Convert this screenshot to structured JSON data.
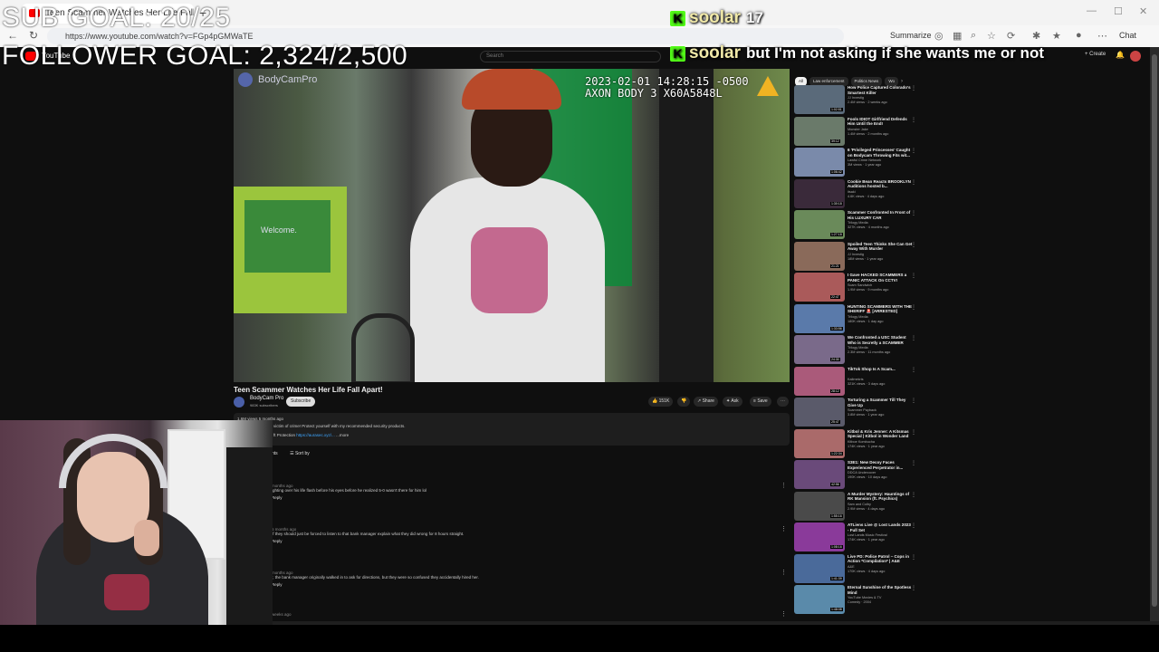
{
  "browser": {
    "tab_title": "Teen Scammer Watches Her Life Fall Apart",
    "url": "https://www.youtube.com/watch?v=FGp4pGMWaTE",
    "summarize_label": "Summarize",
    "chat_label": "Chat"
  },
  "youtube": {
    "logo_text": "YouTube",
    "search_placeholder": "Search",
    "create_label": "+ Create",
    "video": {
      "watermark_channel": "BodyCamPro",
      "hud_line1": "2023-02-01 14:28:15 -0500",
      "hud_line2": "AXON BODY 3 X60A5848L",
      "sign_text": "Welcome.",
      "title": "Teen Scammer Watches Her Life Fall Apart!",
      "channel": "BodyCam Pro",
      "subscribers": "983K subscribers",
      "subscribe_label": "Subscribe",
      "likes": "151K",
      "share_label": "Share",
      "ask_label": "Ask",
      "save_label": "Save",
      "views_line": "1.6M views  5 months ago",
      "desc_line1": "victim of crime! Protect yourself with my recommended security products.",
      "desc_line2_prefix": "ft Protection",
      "desc_link": "https://aurasec.xyz/...",
      "desc_more": "...more"
    },
    "comments": {
      "header": "nts",
      "sort_label": "Sort by",
      "items": [
        {
          "meta": "months ago",
          "text": "ighting over his life flash before his eyes before he realized 5-0 wasn't there for him lol",
          "reply": "Reply"
        },
        {
          "meta": "5 months ago",
          "text": "If they should just be forced to listen to that bank manager explain what they did wrong for 8 hours straight.",
          "reply": "Reply"
        },
        {
          "meta": "months ago",
          "text": "r, the bank manager originally walked in to ask for directions, but they were so confused they accidentally hired her.",
          "reply": "Reply"
        },
        {
          "meta": "weeks ago",
          "text": "",
          "reply": ""
        }
      ]
    },
    "chips": [
      "All",
      "Law enforcement",
      "Politics News",
      "Wo"
    ],
    "recommendations": [
      {
        "title": "How Police Captured Colorado's Smartest Killer",
        "channel": "JJ Investig",
        "meta": "2.4M views · 2 weeks ago",
        "duration": "1:02:51",
        "color": "#5a6a7a"
      },
      {
        "title": "Fools IDIOT Girlfriend Defends Him Until the End!",
        "channel": "Monster Jake",
        "meta": "1.4M views · 2 months ago",
        "duration": "39:12",
        "color": "#6a7a6a"
      },
      {
        "title": "6 'Privileged Princesses' Caught on Bodycam Throwing Fits wit...",
        "channel": "Lawful Crime Network",
        "meta": "3M views · 1 year ago",
        "duration": "1:06:42",
        "color": "#7a8aaa"
      },
      {
        "title": "Cookie Bean Reacts BROOKLYN Auditions hosted b...",
        "channel": "itsaki",
        "meta": "4.6K views · 4 days ago",
        "duration": "1:30:18",
        "color": "#3a2a3a"
      },
      {
        "title": "Scammer Confronted In Front of His LUXURY CAR",
        "channel": "Trilogy Media",
        "meta": "327K views · 4 months ago",
        "duration": "1:27:18",
        "color": "#6a8a5a"
      },
      {
        "title": "Spoiled Teen Thinks She Can Get Away With Murder",
        "channel": "JJ Investig",
        "meta": "18M views · 1 year ago",
        "duration": "21:21",
        "color": "#8a6a5a"
      },
      {
        "title": "I Gave HACKED SCAMMERS a PANIC ATTACK On CCTV!",
        "channel": "Scam Sandwich",
        "meta": "1.9M views · 9 months ago",
        "duration": "22:47",
        "color": "#aa5a5a"
      },
      {
        "title": "HUNTING SCAMMERS WITH THE SHERIFF 🚨 [ARRESTED]",
        "channel": "Trilogy Media",
        "meta": "180K views · 1 day ago",
        "duration": "1:33:56",
        "color": "#5a7aaa"
      },
      {
        "title": "We Confronted a USC Student Who is Secretly a SCAMMER",
        "channel": "Trilogy Media",
        "meta": "2.3M views · 11 months ago",
        "duration": "24:30",
        "color": "#7a6a8a"
      },
      {
        "title": "TikTok Shop Is A Scam...",
        "channel": "Kallmekris",
        "meta": "321K views · 3 days ago",
        "duration": "28:12",
        "color": "#aa5a7a"
      },
      {
        "title": "Torturing a Scammer Till They Give Up",
        "channel": "Scammer Payback",
        "meta": "3.8M views · 1 year ago",
        "duration": "25:47",
        "color": "#5a5a6a"
      },
      {
        "title": "Kitbol & Kris Jenner: A Kitsmas Special | Kitbol in Wonder Land",
        "channel": "Kitboe Kombucha",
        "meta": "174K views · 1 year ago",
        "duration": "1:22:34",
        "color": "#aa6a6a"
      },
      {
        "title": "S3E1: New Decoy Faces Experienced Perpetrator in...",
        "channel": "DDCA Undercover",
        "meta": "190K views · 10 days ago",
        "duration": "42:56",
        "color": "#6a4a7a"
      },
      {
        "title": "A Murder Mystery: Hauntings of RK Mansion (ft. Psychics)",
        "channel": "Sam and Colby",
        "meta": "2.9M views · 4 days ago",
        "duration": "1:55:16",
        "color": "#4a4a4a"
      },
      {
        "title": "ATLiens Live @ Lost Lands 2023 - Full Set",
        "channel": "Lost Lands Music Festival",
        "meta": "174K views · 1 year ago",
        "duration": "1:08:16",
        "color": "#8a3a9a"
      },
      {
        "title": "Live PD: Police Patrol – Cops in Action *Compilation* | A&E",
        "channel": "A&E",
        "meta": "170K views · 4 days ago",
        "duration": "1:41:39",
        "color": "#4a6a9a"
      },
      {
        "title": "Eternal Sunshine of the Spotless Mind",
        "channel": "YouTube Movies & TV",
        "meta": "Comedy · 2004",
        "duration": "1:48:08",
        "color": "#5a8aaa"
      }
    ]
  },
  "overlay": {
    "sub_goal": "SUB GOAL: 20/25",
    "follower_goal": "FOLLOWER GOAL: 2,324/2,500",
    "chat": [
      {
        "user": "soolar",
        "message": "17"
      },
      {
        "user": "soolar",
        "message": "but I'm not asking if she wants me or not"
      }
    ],
    "kick_badge": "K"
  }
}
